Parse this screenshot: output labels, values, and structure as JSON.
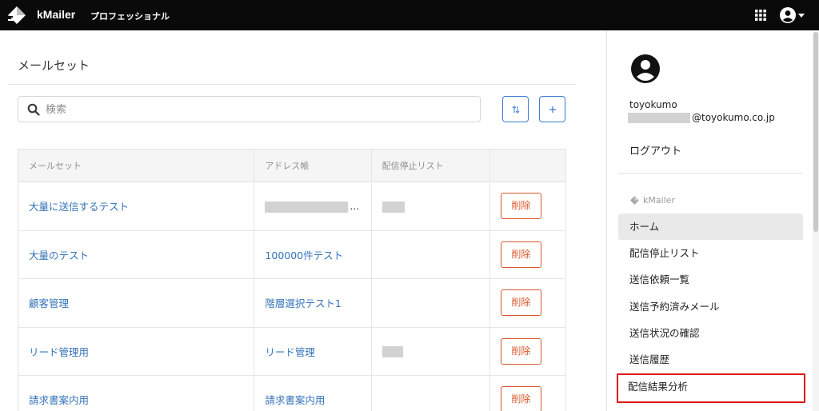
{
  "header": {
    "brand": "kMailer",
    "edition": "プロフェッショナル"
  },
  "main": {
    "title": "メールセット",
    "search_placeholder": "検索",
    "columns": [
      "メールセット",
      "アドレス帳",
      "配信停止リスト",
      ""
    ],
    "rows": [
      {
        "name": "大量に送信するテスト",
        "address_book": "…",
        "delete_label": "削除"
      },
      {
        "name": "大量のテスト",
        "address_book": "100000件テスト",
        "delete_label": "削除"
      },
      {
        "name": "顧客管理",
        "address_book": "階層選択テスト1",
        "delete_label": "削除"
      },
      {
        "name": "リード管理用",
        "address_book": "リード管理",
        "delete_label": "削除"
      },
      {
        "name": "請求書案内用",
        "address_book": "請求書案内用",
        "delete_label": "削除"
      }
    ]
  },
  "side": {
    "username": "toyokumo",
    "email_domain": "@toyokumo.co.jp",
    "logout": "ログアウト",
    "brand": "kMailer",
    "nav": [
      {
        "label": "ホーム"
      },
      {
        "label": "配信停止リスト"
      },
      {
        "label": "送信依頼一覧"
      },
      {
        "label": "送信予約済みメール"
      },
      {
        "label": "送信状況の確認"
      },
      {
        "label": "送信履歴"
      },
      {
        "label": "配信結果分析"
      }
    ]
  },
  "colors": {
    "accent": "#3a7bd5",
    "danger": "#d9582b",
    "highlight": "#e01b1b"
  }
}
